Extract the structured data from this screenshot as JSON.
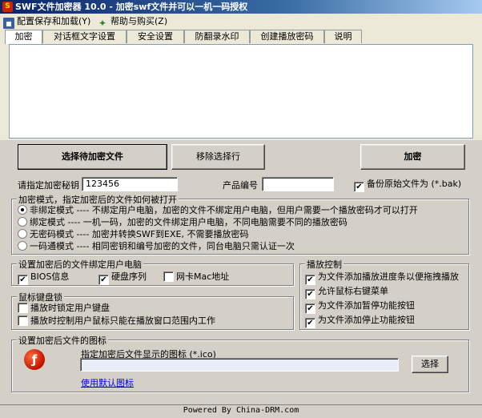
{
  "window": {
    "title": "SWF文件加密器 10.0 - 加密swf文件并可以一机一码授权"
  },
  "menu": [
    {
      "label": "配置保存和加载(Y)",
      "icon": "floppy-icon"
    },
    {
      "label": "帮助与购买(Z)",
      "icon": "help-icon"
    }
  ],
  "tabs": [
    "加密",
    "对话框文字设置",
    "安全设置",
    "防翻录水印",
    "创建播放密码",
    "说明"
  ],
  "buttons": {
    "select_files": "选择待加密文件",
    "remove": "移除选择行",
    "encrypt": "加密",
    "choose_icon": "选择"
  },
  "key": {
    "label": "请指定加密秘钥",
    "value": "123456"
  },
  "product": {
    "label": "产品编号",
    "value": ""
  },
  "backup": {
    "label": "备份原始文件为 (*.bak)",
    "checked": true
  },
  "mode_group": {
    "legend": "加密模式，指定加密后的文件如何被打开",
    "options": [
      {
        "label": "非绑定模式 ---- 不绑定用户电脑，加密的文件不绑定用户电脑，但用户需要一个播放密码才可以打开",
        "selected": true
      },
      {
        "label": "绑定模式 ---- 一机一码，加密的文件绑定用户电脑，不同电脑需要不同的播放密码",
        "selected": false
      },
      {
        "label": "无密码模式 ---- 加密并转换SWF到EXE, 不需要播放密码",
        "selected": false
      },
      {
        "label": "一码通模式 ---- 相同密钥和编号加密的文件，同台电脑只需认证一次",
        "selected": false
      }
    ]
  },
  "bind_group": {
    "legend": "设置加密后的文件绑定用户电脑",
    "items": [
      {
        "label": "BIOS信息",
        "checked": true
      },
      {
        "label": "硬盘序列",
        "checked": true
      },
      {
        "label": "网卡Mac地址",
        "checked": false
      }
    ]
  },
  "kb_group": {
    "legend": "鼠标键盘锁",
    "items": [
      {
        "label": "播放时锁定用户键盘",
        "checked": false
      },
      {
        "label": "播放时控制用户鼠标只能在播放窗口范围内工作",
        "checked": false
      }
    ]
  },
  "play_group": {
    "legend": "播放控制",
    "items": [
      {
        "label": "为文件添加播放进度条以便拖拽播放",
        "checked": true
      },
      {
        "label": "允许鼠标右键菜单",
        "checked": true
      },
      {
        "label": "为文件添加暂停功能按钮",
        "checked": true
      },
      {
        "label": "为文件添加停止功能按钮",
        "checked": true
      }
    ]
  },
  "icon_group": {
    "legend": "设置加密后文件的图标",
    "prompt": "指定加密后文件显示的图标 (*.ico)",
    "path": "",
    "default_link": "使用默认图标"
  },
  "footer": {
    "text": "Powered By China-DRM.com"
  },
  "checkmark": "✔"
}
